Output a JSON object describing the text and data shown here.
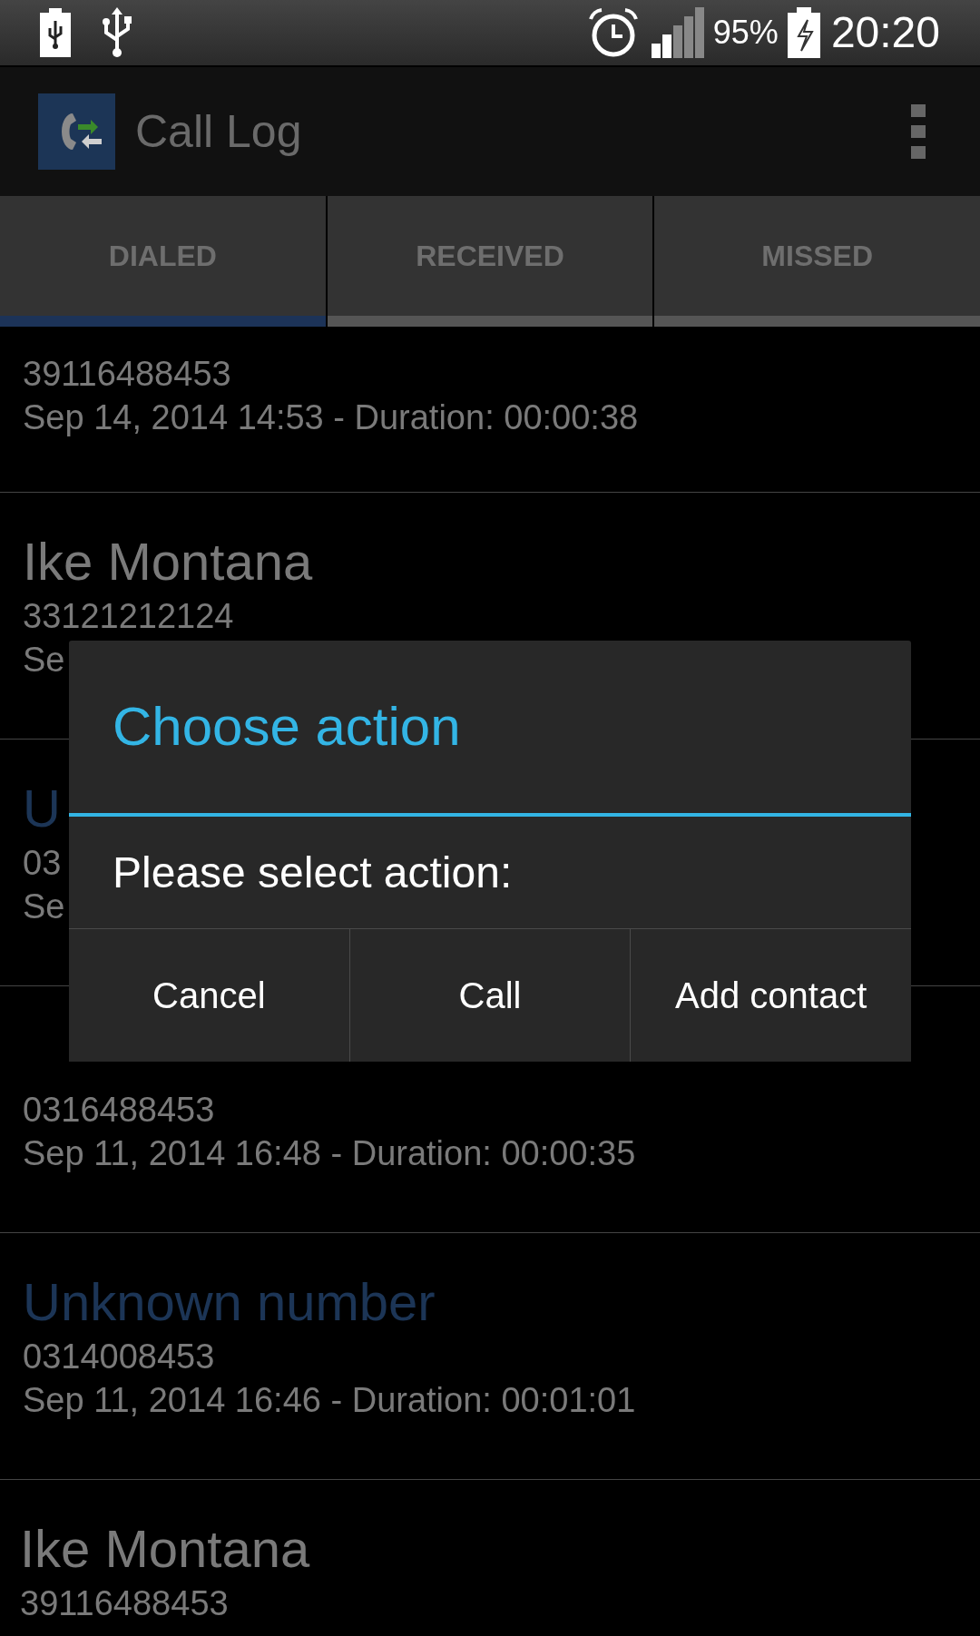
{
  "status_bar": {
    "battery_percent": "95%",
    "time": "20:20"
  },
  "app_bar": {
    "title": "Call Log"
  },
  "tabs": [
    {
      "label": "DIALED",
      "selected": true
    },
    {
      "label": "RECEIVED",
      "selected": false
    },
    {
      "label": "MISSED",
      "selected": false
    }
  ],
  "calls": [
    {
      "number": "39116488453",
      "details": "Sep 14, 2014 14:53 - Duration: 00:00:38"
    },
    {
      "kind": "contact",
      "name": "Ike Montana",
      "number": "33121212124",
      "details": "Se"
    },
    {
      "kind": "unknown",
      "name": "U",
      "number": "03",
      "details": "Se"
    },
    {
      "number": "0316488453",
      "details": "Sep 11, 2014 16:48 - Duration: 00:00:35"
    },
    {
      "kind": "unknown",
      "name": "Unknown number",
      "number": "0314008453",
      "details": "Sep 11, 2014 16:46 - Duration: 00:01:01"
    },
    {
      "kind": "contact",
      "name": "Ike Montana",
      "number": "39116488453"
    }
  ],
  "dialog": {
    "title": "Choose action",
    "message": "Please select action:",
    "buttons": [
      "Cancel",
      "Call",
      "Add contact"
    ]
  }
}
